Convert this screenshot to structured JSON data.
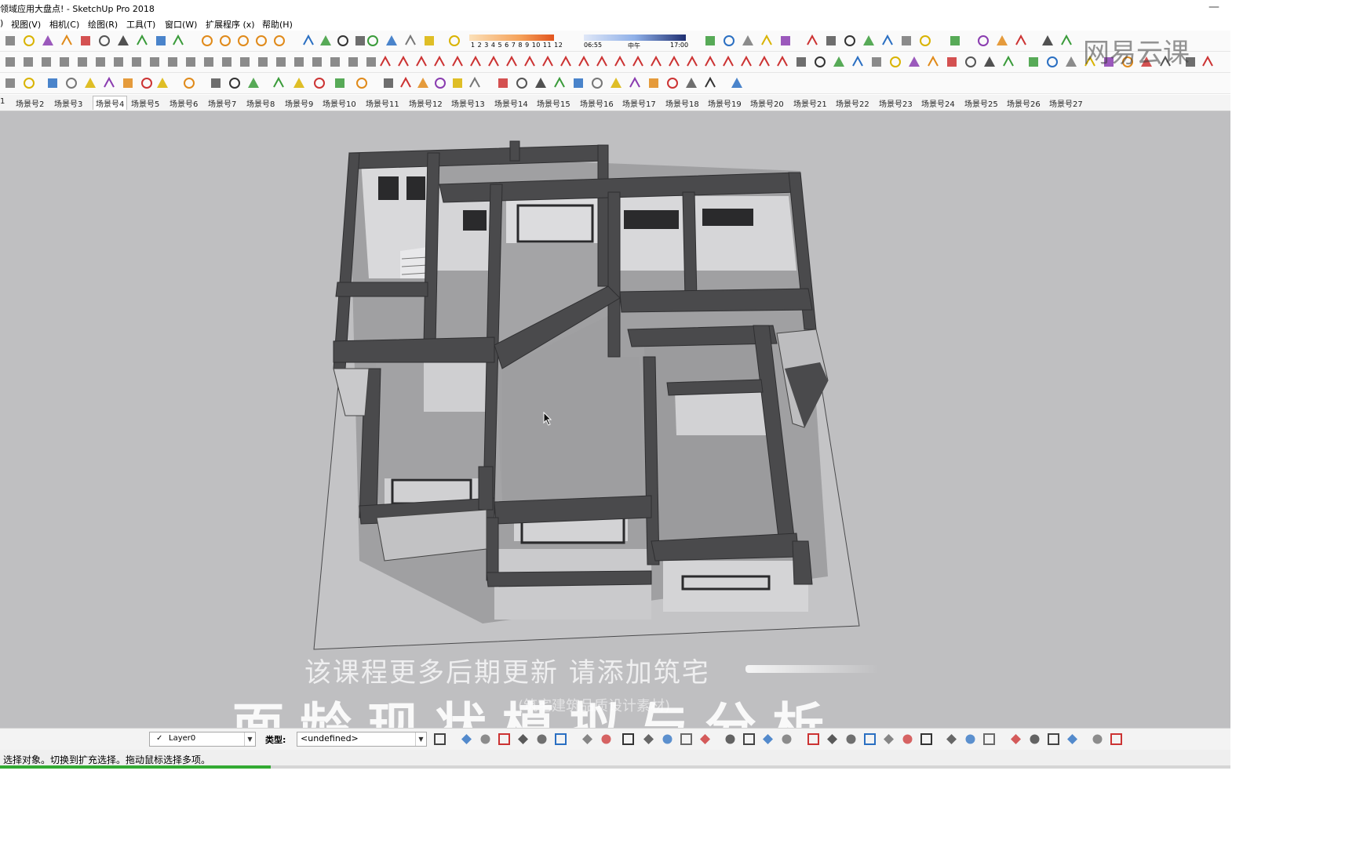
{
  "window": {
    "title": "领域应用大盘点! - SketchUp Pro 2018",
    "close_glyph": "—"
  },
  "menu": [
    {
      "label": "视图(V)"
    },
    {
      "label": "相机(C)"
    },
    {
      "label": "绘图(R)"
    },
    {
      "label": "工具(T)"
    },
    {
      "label": "窗口(W)"
    },
    {
      "label": "扩展程序 (x)"
    },
    {
      "label": "帮助(H)"
    }
  ],
  "shadow_settings": {
    "months": "1 2 3 4 5 6 7 8 9 10 11 12",
    "time_start": "06:55",
    "time_mid": "中午",
    "time_end": "17:00"
  },
  "scenes": [
    "1",
    "场景号2",
    "场景号3",
    "场景号4",
    "场景号5",
    "场景号6",
    "场景号7",
    "场景号8",
    "场景号9",
    "场景号10",
    "场景号11",
    "场景号12",
    "场景号13",
    "场景号14",
    "场景号15",
    "场景号16",
    "场景号17",
    "场景号18",
    "场景号19",
    "场景号20",
    "场景号21",
    "场景号22",
    "场景号23",
    "场景号24",
    "场景号25",
    "场景号26",
    "场景号27"
  ],
  "active_scene": "场景号4",
  "overlay": {
    "watermark": "网易云课",
    "subtitle": "该课程更多后期更新  请添加筑宅",
    "subtitle_small": "(筑宅建筑品质设计素材)",
    "big_text": "面龄现状模拟与分析"
  },
  "bottom_toolbar": {
    "layer": "Layer0",
    "type_label": "类型:",
    "type_value": "<undefined>"
  },
  "status": {
    "text": "选择对象。切换到扩充选择。拖动鼠标选择多项。",
    "progress": 0.22
  },
  "colors": {
    "viewport": "#bfbfc1",
    "wall": "#4a4a4c",
    "floor": "#9c9c9e",
    "toolbar_bg": "#fafafa"
  }
}
